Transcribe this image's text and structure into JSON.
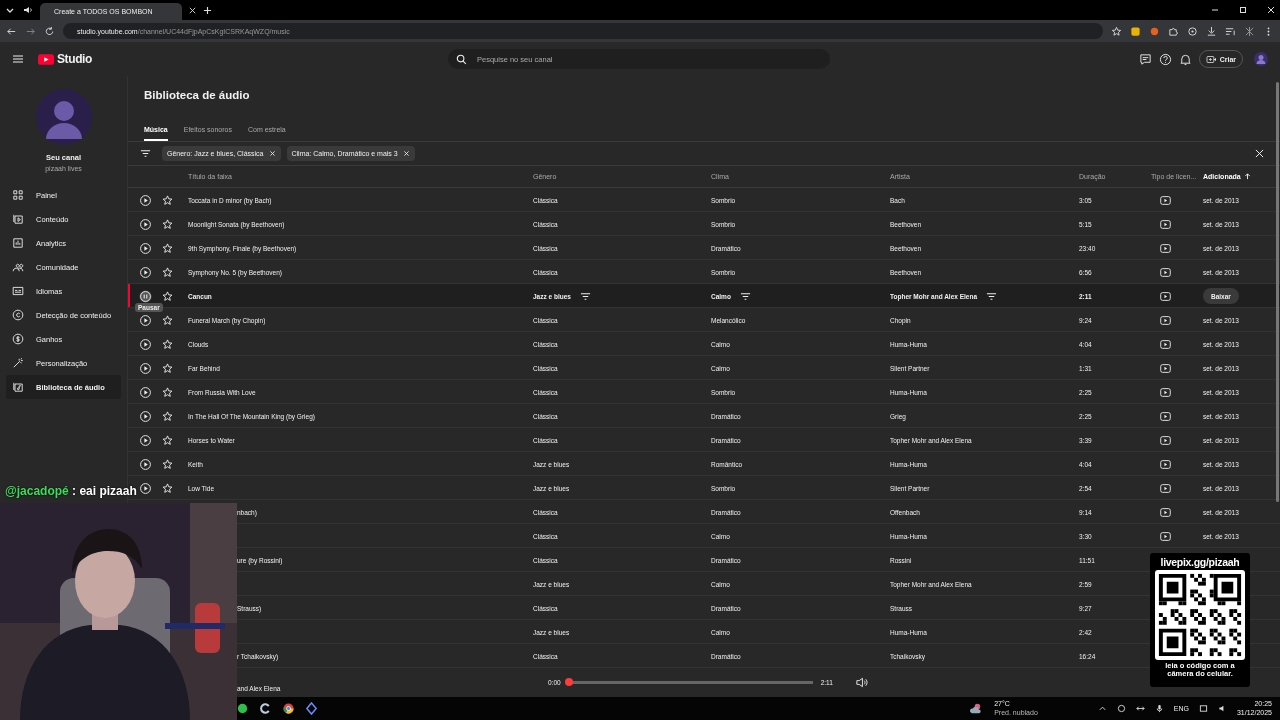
{
  "browser": {
    "tab_title": "Create a TODOS OS BOMBON",
    "url_host": "studio.youtube.com",
    "url_path": "/channel/UC44dFjpApCsKgICSRKAqWZQ/music"
  },
  "header": {
    "logo": "Studio",
    "search_placeholder": "Pesquise no seu canal",
    "create_label": "Criar"
  },
  "channel": {
    "name": "Seu canal",
    "handle": "pizaah lives"
  },
  "sidebar": {
    "items": [
      {
        "label": "Painel",
        "selected": false
      },
      {
        "label": "Conteúdo",
        "selected": false
      },
      {
        "label": "Analytics",
        "selected": false
      },
      {
        "label": "Comunidade",
        "selected": false
      },
      {
        "label": "Idiomas",
        "selected": false
      },
      {
        "label": "Detecção de conteúdo",
        "selected": false
      },
      {
        "label": "Ganhos",
        "selected": false
      },
      {
        "label": "Personalização",
        "selected": false
      },
      {
        "label": "Biblioteca de áudio",
        "selected": true
      }
    ]
  },
  "page_title": "Biblioteca de áudio",
  "tabs": [
    {
      "label": "Música",
      "selected": true
    },
    {
      "label": "Efeitos sonoros",
      "selected": false
    },
    {
      "label": "Com estrela",
      "selected": false
    }
  ],
  "filters": [
    {
      "label": "Gênero: Jazz e blues, Clássica"
    },
    {
      "label": "Clima: Calmo, Dramático e mais 3"
    }
  ],
  "table": {
    "columns": [
      {
        "label": "Título da faixa",
        "sorted": false
      },
      {
        "label": "Gênero",
        "sorted": false
      },
      {
        "label": "Clima",
        "sorted": false
      },
      {
        "label": "Artista",
        "sorted": false
      },
      {
        "label": "Duração",
        "sorted": false
      },
      {
        "label": "Tipo de licen...",
        "sorted": false
      },
      {
        "label": "Adicionada",
        "sorted": true
      }
    ],
    "rows": [
      {
        "title": "Toccata in D minor (by Bach)",
        "genre": "Clássica",
        "mood": "Sombrio",
        "artist": "Bach",
        "duration": "3:05",
        "license": true,
        "added": "set. de 2013",
        "selected": false,
        "covered": false
      },
      {
        "title": "Moonlight Sonata (by Beethoven)",
        "genre": "Clássica",
        "mood": "Sombrio",
        "artist": "Beethoven",
        "duration": "5:15",
        "license": true,
        "added": "set. de 2013",
        "selected": false,
        "covered": false
      },
      {
        "title": "9th Symphony, Finale (by Beethoven)",
        "genre": "Clássica",
        "mood": "Dramático",
        "artist": "Beethoven",
        "duration": "23:40",
        "license": true,
        "added": "set. de 2013",
        "selected": false,
        "covered": false
      },
      {
        "title": "Symphony No. 5 (by Beethoven)",
        "genre": "Clássica",
        "mood": "Sombrio",
        "artist": "Beethoven",
        "duration": "6:56",
        "license": true,
        "added": "set. de 2013",
        "selected": false,
        "covered": false
      },
      {
        "title": "Cancun",
        "genre": "Jazz e blues",
        "mood": "Calmo",
        "artist": "Topher Mohr and Alex Elena",
        "duration": "2:11",
        "license": true,
        "action": "Baixar",
        "tooltip": "Pausar",
        "selected": true,
        "covered": false
      },
      {
        "title": "Funeral March (by Chopin)",
        "genre": "Clássica",
        "mood": "Melancólico",
        "artist": "Chopin",
        "duration": "9:24",
        "license": true,
        "added": "set. de 2013",
        "selected": false,
        "covered": false
      },
      {
        "title": "Clouds",
        "genre": "Clássica",
        "mood": "Calmo",
        "artist": "Huma-Huma",
        "duration": "4:04",
        "license": true,
        "added": "set. de 2013",
        "selected": false,
        "covered": false
      },
      {
        "title": "Far Behind",
        "genre": "Clássica",
        "mood": "Calmo",
        "artist": "Silent Partner",
        "duration": "1:31",
        "license": true,
        "added": "set. de 2013",
        "selected": false,
        "covered": false
      },
      {
        "title": "From Russia With Love",
        "genre": "Clássica",
        "mood": "Sombrio",
        "artist": "Huma-Huma",
        "duration": "2:25",
        "license": true,
        "added": "set. de 2013",
        "selected": false,
        "covered": false
      },
      {
        "title": "In The Hall Of The Mountain King (by Grieg)",
        "genre": "Clássica",
        "mood": "Dramático",
        "artist": "Grieg",
        "duration": "2:25",
        "license": true,
        "added": "set. de 2013",
        "selected": false,
        "covered": false
      },
      {
        "title": "Horses to Water",
        "genre": "Clássica",
        "mood": "Dramático",
        "artist": "Topher Mohr and Alex Elena",
        "duration": "3:39",
        "license": true,
        "added": "set. de 2013",
        "selected": false,
        "covered": false
      },
      {
        "title": "Keith",
        "genre": "Jazz e blues",
        "mood": "Romântico",
        "artist": "Huma-Huma",
        "duration": "4:04",
        "license": true,
        "added": "set. de 2013",
        "selected": false,
        "covered": false
      },
      {
        "title": "Low Tide",
        "genre": "Jazz e blues",
        "mood": "Sombrio",
        "artist": "Silent Partner",
        "duration": "2:54",
        "license": true,
        "added": "set. de 2013",
        "selected": false,
        "covered": false
      },
      {
        "title": "nbach)",
        "genre": "Clássica",
        "mood": "Dramático",
        "artist": "Offenbach",
        "duration": "9:14",
        "license": true,
        "added": "set. de 2013",
        "selected": false,
        "covered": true
      },
      {
        "genre": "Clássica",
        "mood": "Calmo",
        "artist": "Huma-Huma",
        "duration": "3:30",
        "license": true,
        "added": "set. de 2013",
        "selected": false
      },
      {
        "title": "ure (by Rossini)",
        "genre": "Clássica",
        "mood": "Dramático",
        "artist": "Rossini",
        "duration": "11:51",
        "license": false,
        "selected": false,
        "covered": true
      },
      {
        "genre": "Jazz e blues",
        "mood": "Calmo",
        "artist": "Topher Mohr and Alex Elena",
        "duration": "2:59",
        "selected": false
      },
      {
        "title": "Strauss)",
        "genre": "Clássica",
        "mood": "Dramático",
        "artist": "Strauss",
        "duration": "9:27",
        "license": false,
        "selected": false,
        "covered": true
      },
      {
        "genre": "Jazz e blues",
        "mood": "Calmo",
        "artist": "Huma-Huma",
        "duration": "2:42",
        "selected": false
      },
      {
        "title": "r Tchaikovsky)",
        "genre": "Clássica",
        "mood": "Dramático",
        "artist": "Tchaikovsky",
        "duration": "16:24",
        "license": false,
        "selected": false,
        "covered": true
      }
    ]
  },
  "player": {
    "artist_fragment": "and Alex Elena",
    "elapsed": "0:00",
    "total": "2:11",
    "level": 0
  },
  "chat": {
    "user": "@jacadopé",
    "message": ": eai pizaah"
  },
  "donation": {
    "link": "livepix.gg/pizaah",
    "caption": "leia o código com a câmera do celular."
  },
  "taskbar": {
    "temperature": "27°C",
    "weather": "Pred. nublado",
    "language": "ENG",
    "time": "20:25",
    "date": "31/12/2025"
  }
}
